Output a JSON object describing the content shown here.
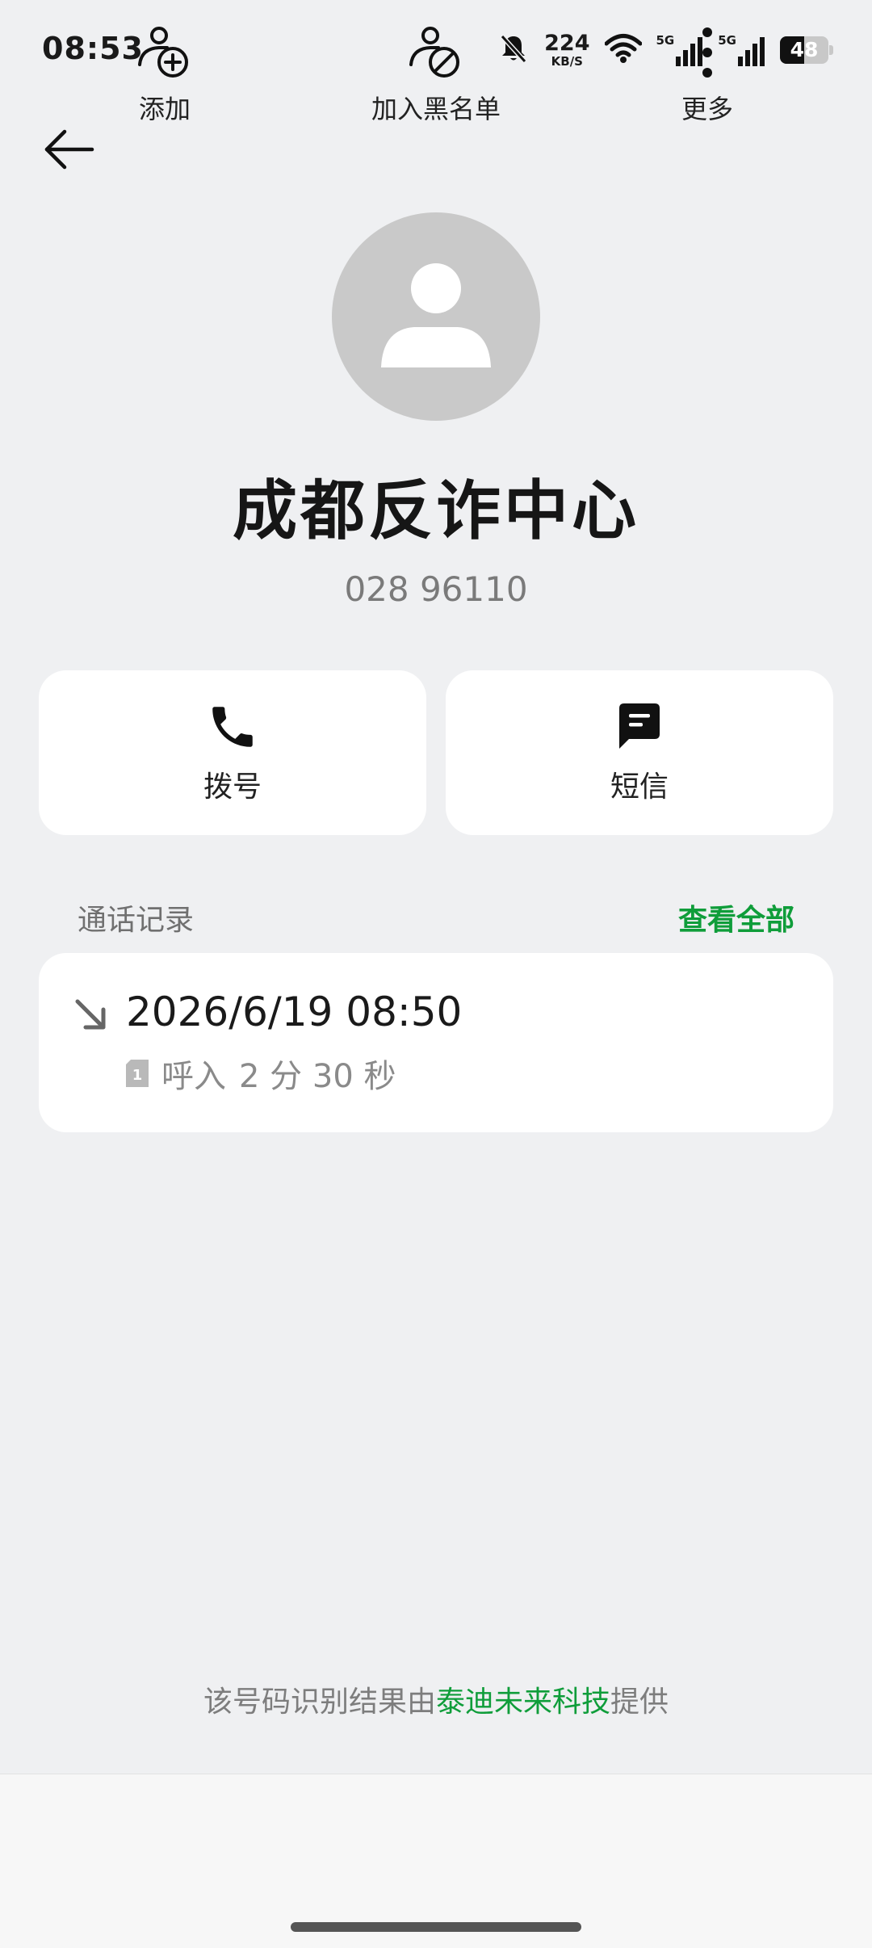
{
  "status_bar": {
    "time": "08:53",
    "speed_value": "224",
    "speed_unit": "KB/S",
    "network_1": "5G",
    "network_2": "5G",
    "battery_level": "48",
    "icons": [
      "bell-muted-icon",
      "wifi-icon",
      "signal-icon",
      "signal-icon",
      "battery-icon"
    ]
  },
  "contact": {
    "name": "成都反诈中心",
    "number": "028 96110"
  },
  "actions": {
    "dial_label": "拨号",
    "sms_label": "短信"
  },
  "call_log": {
    "title": "通话记录",
    "view_all": "查看全部",
    "entries": [
      {
        "time": "2026/6/19 08:50",
        "sim": "1",
        "type": "呼入",
        "duration": "2 分 30 秒",
        "icon": "incoming-call-arrow-icon"
      }
    ]
  },
  "provider": {
    "prefix": "该号码识别结果由",
    "name": "泰迪未来科技",
    "suffix": "提供"
  },
  "bottom_bar": {
    "add_label": "添加",
    "block_label": "加入黑名单",
    "more_label": "更多"
  },
  "colors": {
    "accent": "#0f9d3a",
    "background": "#eff0f2",
    "card": "#ffffff",
    "avatar": "#c9c9c9"
  }
}
